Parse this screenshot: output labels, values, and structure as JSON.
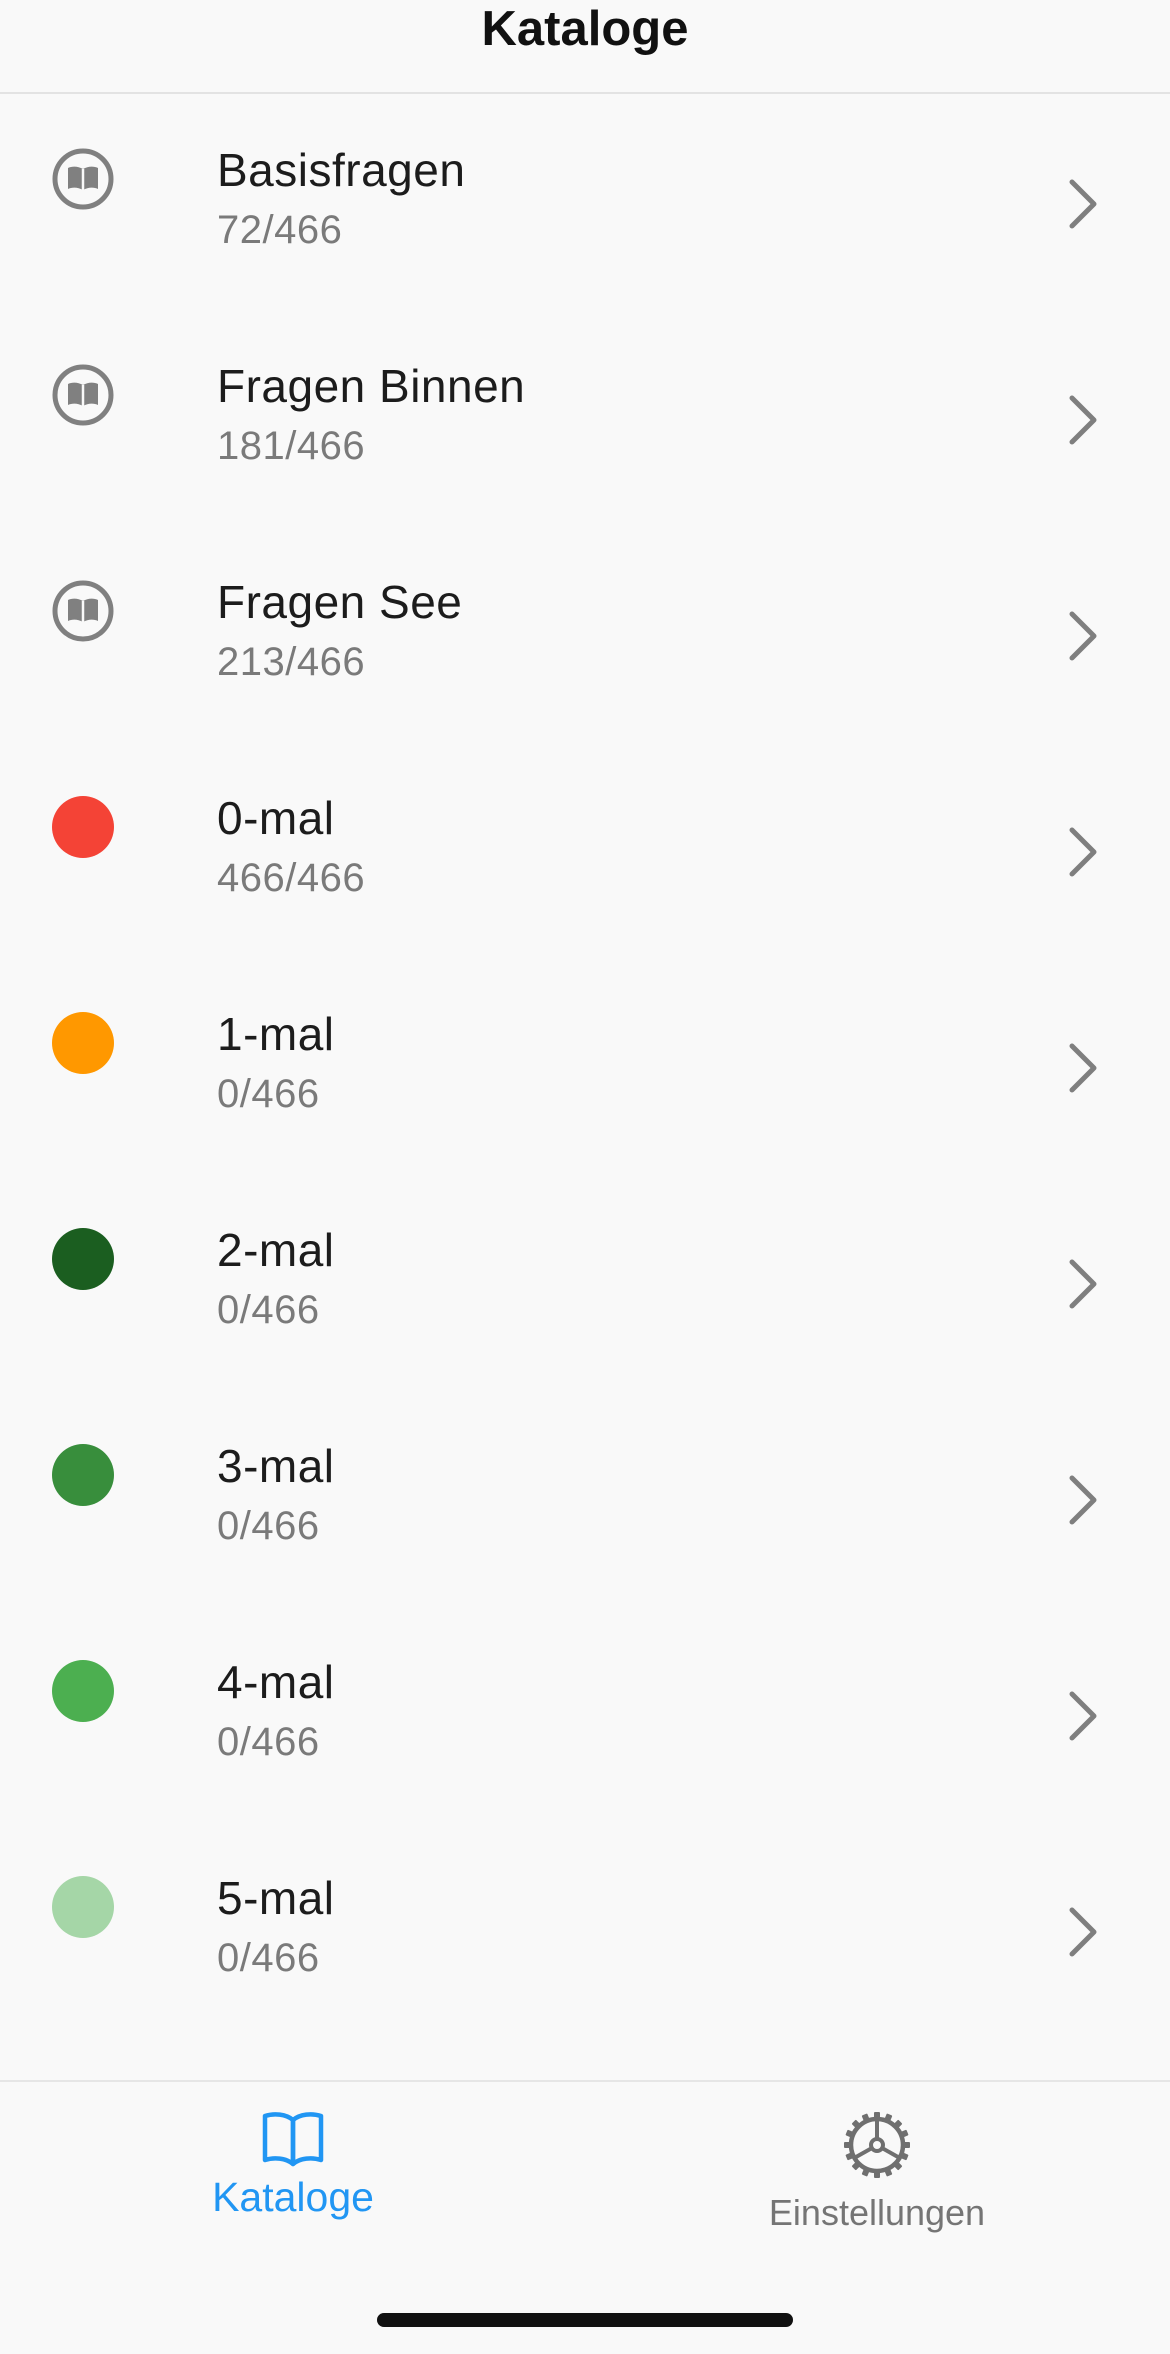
{
  "header": {
    "title": "Kataloge"
  },
  "catalogs": [
    {
      "title": "Basisfragen",
      "progress": "72/466",
      "icon": "book-icon"
    },
    {
      "title": "Fragen Binnen",
      "progress": "181/466",
      "icon": "book-icon"
    },
    {
      "title": "Fragen See",
      "progress": "213/466",
      "icon": "book-icon"
    },
    {
      "title": "0-mal",
      "progress": "466/466",
      "icon": "status-dot",
      "color": "#f44336"
    },
    {
      "title": "1-mal",
      "progress": "0/466",
      "icon": "status-dot",
      "color": "#ff9800"
    },
    {
      "title": "2-mal",
      "progress": "0/466",
      "icon": "status-dot",
      "color": "#1b5e20"
    },
    {
      "title": "3-mal",
      "progress": "0/466",
      "icon": "status-dot",
      "color": "#388e3c"
    },
    {
      "title": "4-mal",
      "progress": "0/466",
      "icon": "status-dot",
      "color": "#4caf50"
    },
    {
      "title": "5-mal",
      "progress": "0/466",
      "icon": "status-dot",
      "color": "#a5d6a7"
    }
  ],
  "tabbar": {
    "catalogs_label": "Kataloge",
    "settings_label": "Einstellungen",
    "active_color": "#2196f3",
    "inactive_color": "#757575"
  }
}
